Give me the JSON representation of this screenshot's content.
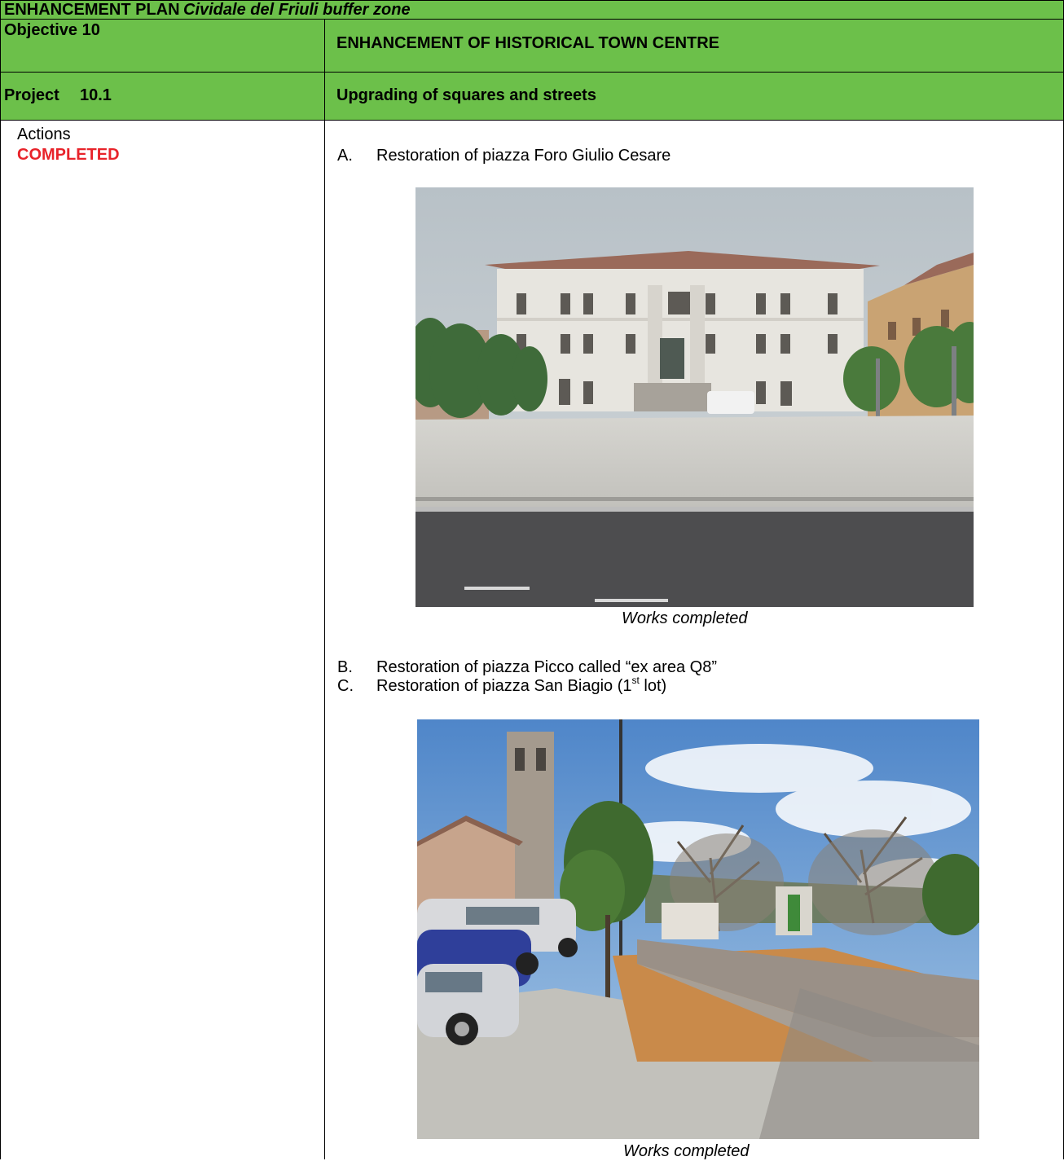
{
  "header": {
    "plan_label": "ENHANCEMENT PLAN",
    "plan_subtitle": "Cividale del Friuli buffer zone"
  },
  "objective": {
    "label": "Objective  10",
    "title": "ENHANCEMENT OF HISTORICAL TOWN CENTRE"
  },
  "project": {
    "label": "Project",
    "number": "10.1",
    "title": "Upgrading of squares and streets"
  },
  "actions": {
    "label": "Actions",
    "status": "COMPLETED",
    "items": [
      {
        "letter": "A.",
        "text": "Restoration of piazza Foro Giulio Cesare"
      },
      {
        "letter": "B.",
        "text": "Restoration of piazza Picco called “ex area Q8”"
      },
      {
        "letter": "C.",
        "text_before": "Restoration of piazza San Biagio (1",
        "sup": "st",
        "text_after": " lot)"
      }
    ],
    "captions": [
      "Works completed",
      "Works completed"
    ]
  },
  "colors": {
    "header_green": "#6cc04a",
    "status_red": "#e8232a"
  }
}
